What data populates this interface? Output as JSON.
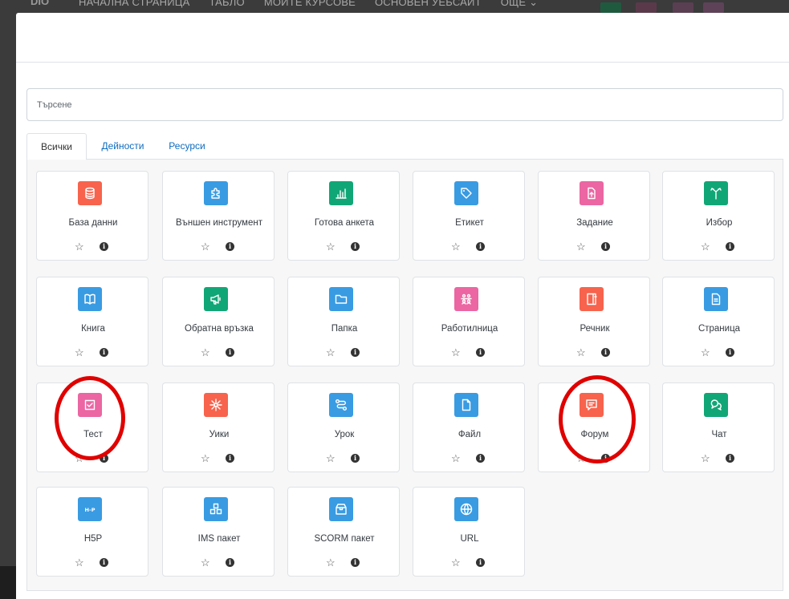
{
  "background_nav": {
    "logo": "DIO",
    "items": [
      "НАЧАЛНА СТРАНИЦА",
      "ТАБЛО",
      "МОИТЕ КУРСОВЕ",
      "ОСНОВЕН УЕБСАЙТ",
      "ОЩЕ ⌄"
    ]
  },
  "search": {
    "placeholder": "Търсене"
  },
  "tabs": [
    "Всички",
    "Дейности",
    "Ресурси"
  ],
  "colors": {
    "red": "#f7634d",
    "blue": "#399be2",
    "green": "#11a676",
    "pink": "#eb66a2",
    "link": "#0f6cbf",
    "highlight": "#e00000"
  },
  "activities": [
    {
      "name": "База данни",
      "icon": "database-icon",
      "color": "#f7634d"
    },
    {
      "name": "Външен инструмент",
      "icon": "puzzle-icon",
      "color": "#399be2"
    },
    {
      "name": "Готова анкета",
      "icon": "bar-chart-icon",
      "color": "#11a676"
    },
    {
      "name": "Етикет",
      "icon": "tag-icon",
      "color": "#399be2"
    },
    {
      "name": "Задание",
      "icon": "file-upload-icon",
      "color": "#eb66a2"
    },
    {
      "name": "Избор",
      "icon": "signpost-icon",
      "color": "#11a676"
    },
    {
      "name": "Книга",
      "icon": "book-icon",
      "color": "#399be2"
    },
    {
      "name": "Обратна връзка",
      "icon": "megaphone-icon",
      "color": "#11a676"
    },
    {
      "name": "Папка",
      "icon": "folder-icon",
      "color": "#399be2"
    },
    {
      "name": "Работилница",
      "icon": "workshop-icon",
      "color": "#eb66a2"
    },
    {
      "name": "Речник",
      "icon": "glossary-icon",
      "color": "#f7634d"
    },
    {
      "name": "Страница",
      "icon": "page-icon",
      "color": "#399be2"
    },
    {
      "name": "Тест",
      "icon": "quiz-icon",
      "color": "#eb66a2"
    },
    {
      "name": "Уики",
      "icon": "wiki-icon",
      "color": "#f7634d"
    },
    {
      "name": "Урок",
      "icon": "lesson-icon",
      "color": "#399be2"
    },
    {
      "name": "Файл",
      "icon": "file-icon",
      "color": "#399be2"
    },
    {
      "name": "Форум",
      "icon": "forum-icon",
      "color": "#f7634d"
    },
    {
      "name": "Чат",
      "icon": "chat-icon",
      "color": "#11a676"
    },
    {
      "name": "H5P",
      "icon": "h5p-icon",
      "color": "#399be2"
    },
    {
      "name": "IMS пакет",
      "icon": "ims-package-icon",
      "color": "#399be2"
    },
    {
      "name": "SCORM пакет",
      "icon": "scorm-package-icon",
      "color": "#399be2"
    },
    {
      "name": "URL",
      "icon": "globe-icon",
      "color": "#399be2"
    }
  ],
  "highlighted": [
    "Тест",
    "Форум"
  ]
}
